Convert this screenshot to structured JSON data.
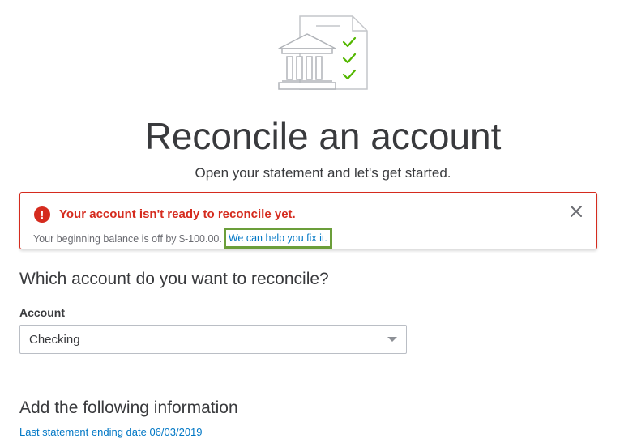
{
  "header": {
    "illustration_icon": "bank-statement-checklist-icon",
    "title": "Reconcile an account",
    "subtitle": "Open your statement and let's get started."
  },
  "alert": {
    "icon": "error-exclamation-icon",
    "title": "Your account isn't ready to reconcile yet.",
    "message": "Your beginning balance is off by $-100.00.",
    "link_label": "We can help you fix it.",
    "close_icon": "close-icon",
    "color": "#d52b1e"
  },
  "account_section": {
    "heading": "Which account do you want to reconcile?",
    "field_label": "Account",
    "selected_value": "Checking"
  },
  "info_section": {
    "heading": "Add the following information",
    "last_statement_label": "Last statement ending date 06/03/2019"
  },
  "colors": {
    "link": "#0077c5",
    "check_green": "#53b700",
    "highlight_border": "#6b9e3a",
    "text": "#393a3d"
  }
}
